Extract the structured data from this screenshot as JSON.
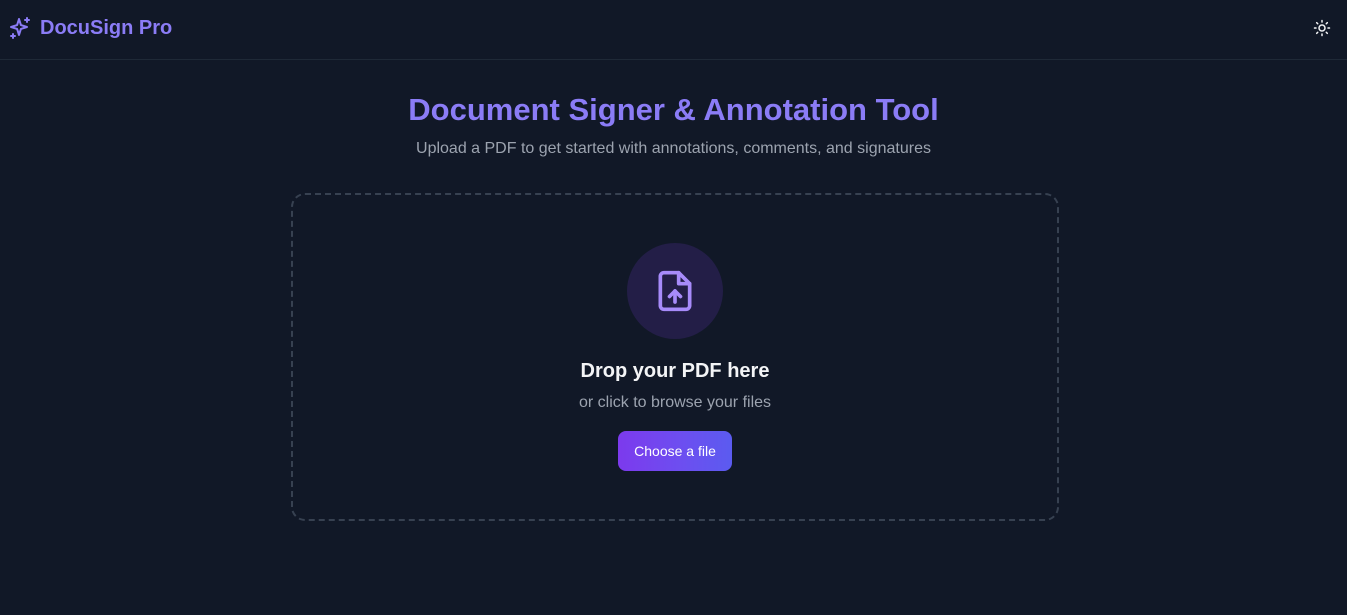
{
  "header": {
    "brand_icon": "sparkles-icon",
    "brand_name": "DocuSign Pro",
    "theme_toggle_icon": "sun-icon"
  },
  "main": {
    "title": "Document Signer & Annotation Tool",
    "subtitle": "Upload a PDF to get started with annotations, comments, and signatures"
  },
  "dropzone": {
    "icon": "file-upload-icon",
    "title": "Drop your PDF here",
    "subtitle": "or click to browse your files",
    "button_label": "Choose a file"
  },
  "colors": {
    "background": "#111827",
    "accent": "#8b7cf6",
    "button_gradient_start": "#7c3aed",
    "button_gradient_end": "#5b5bf0"
  }
}
